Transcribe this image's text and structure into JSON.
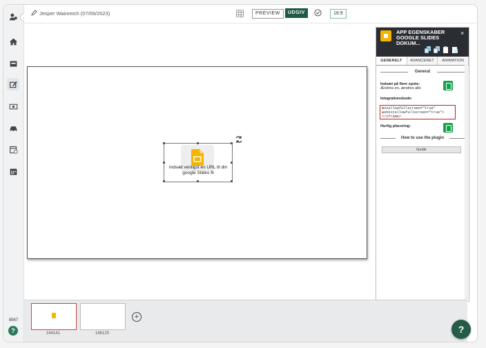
{
  "header": {
    "author": "Jesper Wainreich (07/09/2023)",
    "preview_label": "PREVIEW",
    "publish_label": "UDGIV",
    "ratio_label": "16:9"
  },
  "canvas": {
    "widget_text": "Indsæt venligst en URL til din google Slides fil"
  },
  "filmstrip": {
    "thumbs": [
      {
        "id": "164141"
      },
      {
        "id": "168125"
      }
    ],
    "add_symbol": "+"
  },
  "panel": {
    "title": "APP EGENSKABER GOOGLE SLIDES DOKUM...",
    "close_symbol": "×",
    "tabs": [
      "GENERELT",
      "AVANCERET",
      "ANIMATION"
    ],
    "general_heading": "General",
    "multi_post_label": "Indsæt på flere spots:",
    "multi_post_sub": "Ændres en, ændres alle",
    "integration_label": "Integrationskode:",
    "code_lines": [
      "mozallowfullscreen=\"true\"",
      "webkitallowfullscreen=\"true\">",
      "</iframe>"
    ],
    "quick_label": "Hurtig placering:",
    "plugin_heading": "How to use the plugin",
    "guide_label": "Guide"
  },
  "sidebar": {
    "version": "8567",
    "help_small": "?"
  },
  "help_big": "?",
  "colors": {
    "publish_bg": "#1f5a45",
    "panel_head": "#2a2d31",
    "accent_green": "#18a14d",
    "slides_yellow": "#f5b400",
    "code_border": "#c41d1d"
  }
}
